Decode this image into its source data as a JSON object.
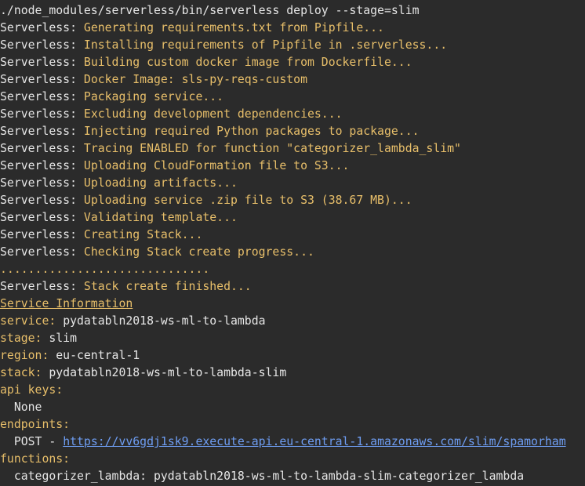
{
  "command": "./node_modules/serverless/bin/serverless deploy --stage=slim",
  "log_prefix": "Serverless: ",
  "log_lines": [
    "Generating requirements.txt from Pipfile...",
    "Installing requirements of Pipfile in .serverless...",
    "Building custom docker image from Dockerfile...",
    "Docker Image: sls-py-reqs-custom",
    "Packaging service...",
    "Excluding development dependencies...",
    "Injecting required Python packages to package...",
    "Tracing ENABLED for function \"categorizer_lambda_slim\"",
    "Uploading CloudFormation file to S3...",
    "Uploading artifacts...",
    "Uploading service .zip file to S3 (38.67 MB)...",
    "Validating template...",
    "Creating Stack...",
    "Checking Stack create progress..."
  ],
  "progress_dots": "..............................",
  "final_log": "Stack create finished...",
  "info_heading": "Service Information",
  "info": {
    "service_key": "service:",
    "service_value": " pydatabln2018-ws-ml-to-lambda",
    "stage_key": "stage:",
    "stage_value": " slim",
    "region_key": "region:",
    "region_value": " eu-central-1",
    "stack_key": "stack:",
    "stack_value": " pydatabln2018-ws-ml-to-lambda-slim",
    "api_keys_key": "api keys:",
    "api_keys_value": "  None",
    "endpoints_key": "endpoints:",
    "endpoint_method": "  POST - ",
    "endpoint_url": "https://vv6gdj1sk9.execute-api.eu-central-1.amazonaws.com/slim/spamorham",
    "functions_key": "functions:",
    "function_entry": "  categorizer_lambda: pydatabln2018-ws-ml-to-lambda-slim-categorizer_lambda"
  },
  "colors": {
    "background": "#2b2b2b",
    "text": "#e6e6e6",
    "accent_yellow": "#e8bf6a",
    "link_blue": "#6e9df2"
  }
}
